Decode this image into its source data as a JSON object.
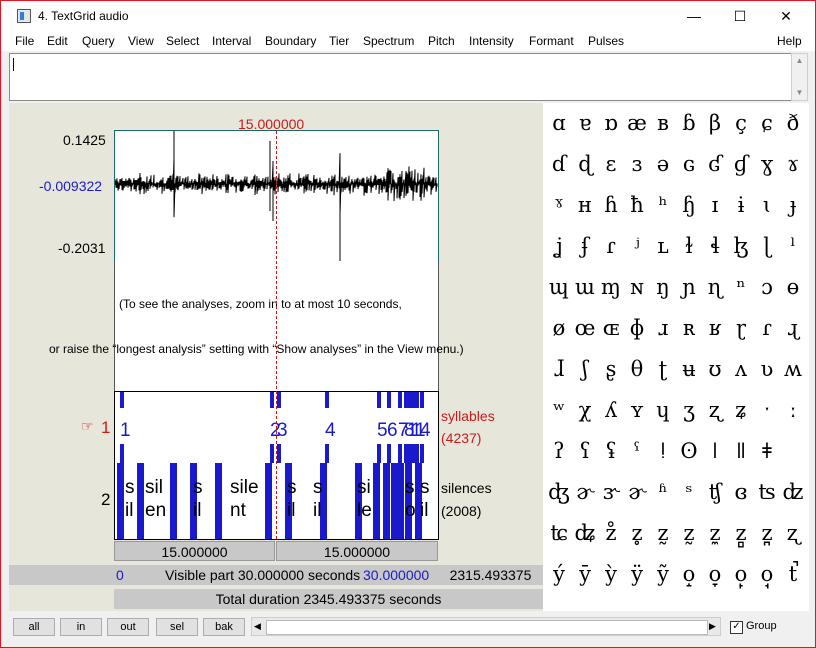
{
  "window": {
    "title": "4. TextGrid audio",
    "minimize": "—",
    "maximize": "☐",
    "close": "✕"
  },
  "menu": [
    "File",
    "Edit",
    "Query",
    "View",
    "Select",
    "Interval",
    "Boundary",
    "Tier",
    "Spectrum",
    "Pitch",
    "Intensity",
    "Formant",
    "Pulses"
  ],
  "help": "Help",
  "editor": {
    "text": ""
  },
  "waveform": {
    "top": "0.1425",
    "mid": "-0.009322",
    "bottom": "-0.2031",
    "cursor": "15.000000"
  },
  "analysis": {
    "line1": "(To see the analyses, zoom in to at most 10 seconds,",
    "line2": "or raise the “longest analysis” setting with “Show analyses” in the View menu.)"
  },
  "tier1": {
    "number": "1",
    "pointer": "☞",
    "name": "syllables",
    "count": "(4237)",
    "labels": [
      "1",
      "2",
      "3",
      "4",
      "5",
      "6",
      "7",
      "8",
      "1",
      "1",
      "1",
      "4"
    ]
  },
  "tier2": {
    "number": "2",
    "name": "silences",
    "count": "(2008)",
    "labels": [
      [
        "s",
        "il"
      ],
      [
        "sil",
        "en"
      ],
      [
        "s",
        "il"
      ],
      [
        "sile",
        "nt"
      ],
      [
        "s",
        "il"
      ],
      [
        "s",
        "il"
      ],
      [
        "si",
        "le"
      ],
      [
        "s",
        "o"
      ],
      [
        "s",
        "il"
      ]
    ]
  },
  "timebar": {
    "left_half": "15.000000",
    "right_half": "15.000000",
    "start": "0",
    "visible": "Visible part 30.000000 seconds",
    "end": "30.000000",
    "after": "2315.493375",
    "total": "Total duration 2345.493375 seconds"
  },
  "buttons": {
    "all": "all",
    "in": "in",
    "out": "out",
    "sel": "sel",
    "bak": "bak"
  },
  "group": {
    "label": "Group",
    "checked": "✓"
  },
  "ipa_chart": [
    [
      "ɑ",
      "ɐ",
      "ɒ",
      "æ",
      "ʙ",
      "ɓ",
      "β",
      "ç",
      "ɕ",
      "ð"
    ],
    [
      "ɗ",
      "ɖ",
      "ɛ",
      "ɜ",
      "ə",
      "ɢ",
      "ʛ",
      "ɠ",
      "ɣ",
      "ɤ"
    ],
    [
      "ˠ",
      "ʜ",
      "ɦ",
      "ħ",
      "ʰ",
      "ɧ",
      "ɪ",
      "ɨ",
      "ɩ",
      "ɟ"
    ],
    [
      "ʝ",
      "ʄ",
      "ɾ",
      "ʲ",
      "ʟ",
      "ɫ",
      "ɬ",
      "ɮ",
      "ɭ",
      "ˡ"
    ],
    [
      "ɰ",
      "ɯ",
      "ɱ",
      "ɴ",
      "ŋ",
      "ɲ",
      "ɳ",
      "ⁿ",
      "ɔ",
      "ɵ"
    ],
    [
      "ø",
      "œ",
      "ɶ",
      "ɸ",
      "ɹ",
      "ʀ",
      "ʁ",
      "ɽ",
      "ɾ",
      "ɻ"
    ],
    [
      "ɺ",
      "ʃ",
      "ʂ",
      "θ",
      "ʈ",
      "ʉ",
      "ʊ",
      "ʌ",
      "ʋ",
      "ʍ"
    ],
    [
      "ʷ",
      "χ",
      "ʎ",
      "ʏ",
      "ɥ",
      "ʒ",
      "ʐ",
      "ʑ",
      "ˑ",
      "ː"
    ],
    [
      "ʔ",
      "ʕ",
      "ʢ",
      "ˤ",
      "ǃ",
      "ʘ",
      "ǀ",
      "ǁ",
      "ǂ",
      ""
    ],
    [
      "ʤ",
      "ɚ",
      "ɝ",
      "ɚ",
      "ʱ",
      "ˢ",
      "ʧ",
      "ɞ",
      "ʦ",
      "ʣ"
    ],
    [
      "ʨ",
      "ʥ",
      "z̊",
      "z̥",
      "z̰",
      "z̰",
      "z̼",
      "z̻",
      "z̪",
      "ʐ"
    ],
    [
      "ý",
      "ȳ",
      "ỳ",
      "ÿ",
      "ỹ",
      "o̝",
      "o̞",
      "o̙",
      "o̘",
      "t̚"
    ]
  ]
}
